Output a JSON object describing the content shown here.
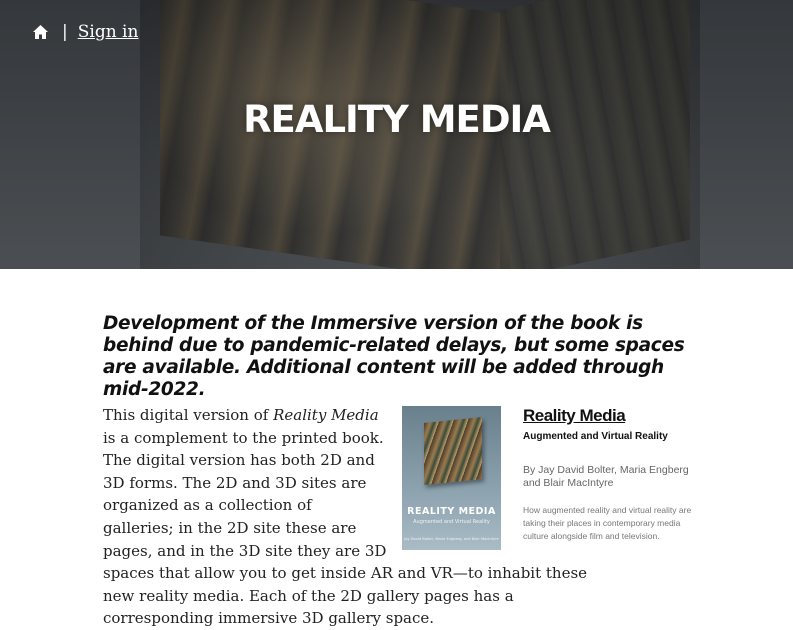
{
  "nav": {
    "home_icon": "home-icon",
    "separator": "|",
    "signin_label": "Sign in"
  },
  "hero": {
    "title": "REALITY MEDIA"
  },
  "notice": "Development of the Immersive version of the book is behind due to pandemic-related delays, but some spaces are available. Additional content will be added through mid-2022.",
  "intro": {
    "lines": [
      "This digital version of ",
      "Reality Media",
      " is a complement to the printed book. The digital version has both 2D and 3D forms. The 2D and 3D sites are organized as a collection of galleries; in the 2D site these are pages, and in the 3D site they are 3D spaces that allow you to get inside AR and VR—to inhabit these new reality media. Each of the 2D gallery pages has a corresponding immersive 3D gallery space."
    ]
  },
  "book": {
    "title": "Reality Media",
    "subtitle": "Augmented and Virtual Reality",
    "authors": "By Jay David Bolter, Maria Engberg and Blair MacIntyre",
    "description": "How augmented reality and virtual reality are taking their places in contemporary media culture alongside film and television.",
    "cover": {
      "title": "REALITY MEDIA",
      "subtitle": "Augmented and Virtual Reality",
      "authors": "Jay David Bolter, Maria Engberg, and Blair MacIntyre"
    }
  },
  "colors": {
    "hero_bg": "#4a4d51",
    "text": "#222222"
  }
}
